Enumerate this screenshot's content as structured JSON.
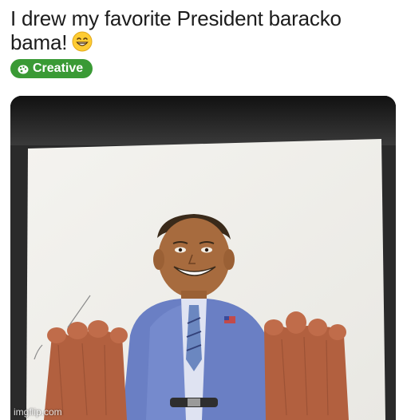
{
  "post": {
    "title": "I drew my favorite President baracko bama!",
    "title_emoji": "grinning-face-emoji",
    "flair": {
      "label": "Creative",
      "icon": "palette-icon",
      "color": "#3a9a35"
    },
    "image": {
      "subject": "crayon-drawing-photo"
    }
  },
  "watermark": "imgflip.com",
  "colors": {
    "background": "#ffffff",
    "text": "#1c1c1c",
    "flair": "#3a9a35"
  }
}
